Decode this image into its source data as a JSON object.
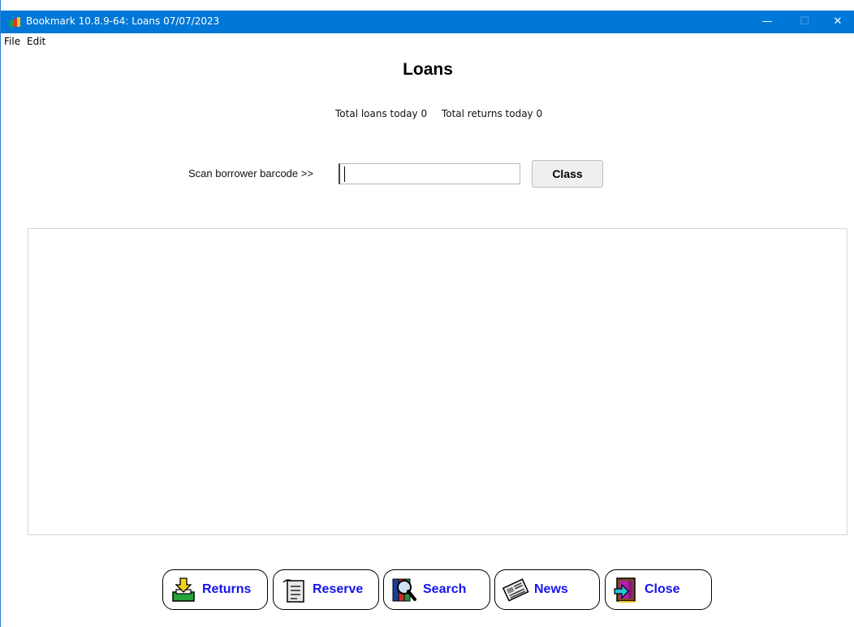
{
  "window": {
    "title": "Bookmark 10.8.9-64: Loans 07/07/2023",
    "controls": {
      "minimize": "—",
      "maximize": "☐",
      "close": "✕"
    }
  },
  "menu": {
    "items": [
      "File",
      "Edit"
    ]
  },
  "page": {
    "title": "Loans",
    "totals": {
      "loans": "Total loans today 0",
      "returns": "Total returns today 0"
    }
  },
  "scan": {
    "label": "Scan borrower barcode >>",
    "value": "",
    "button_label": "Class"
  },
  "toolbar": {
    "buttons": [
      {
        "label": "Returns",
        "icon": "returns-icon"
      },
      {
        "label": "Reserve",
        "icon": "reserve-icon"
      },
      {
        "label": "Search",
        "icon": "search-icon"
      },
      {
        "label": "News",
        "icon": "news-icon"
      },
      {
        "label": "Close",
        "icon": "exit-door-icon"
      }
    ]
  },
  "colors": {
    "titlebar": "#0078d7",
    "button_text": "#1414ee"
  }
}
